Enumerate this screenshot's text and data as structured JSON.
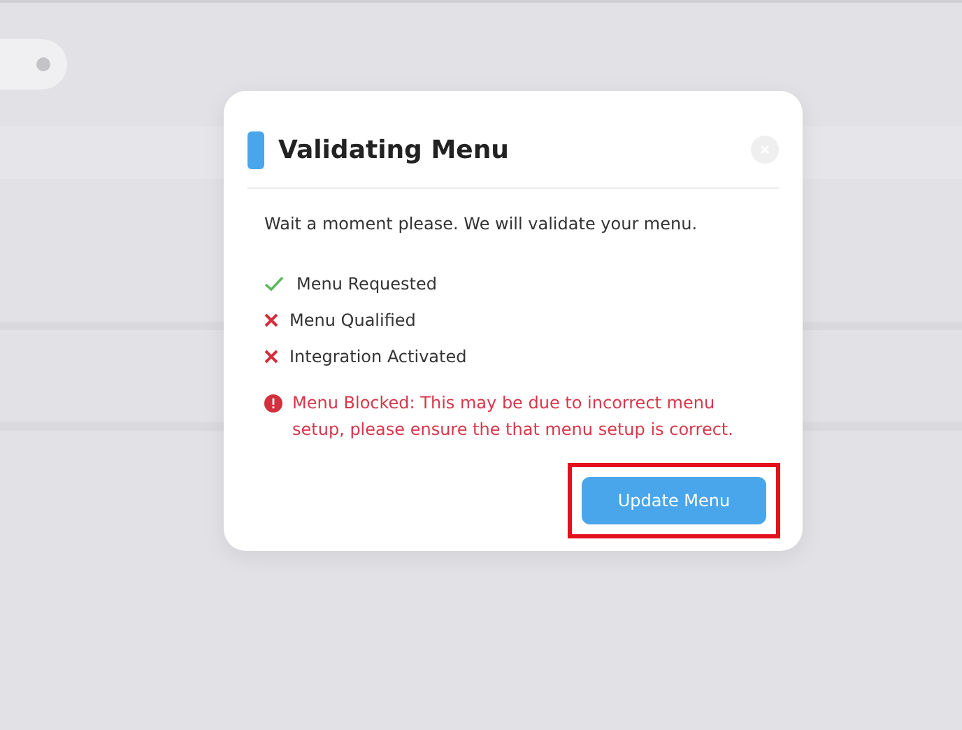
{
  "dialog": {
    "title": "Validating Menu",
    "message": "Wait a moment please. We will validate your menu.",
    "steps": [
      {
        "label": "Menu Requested",
        "passed": true
      },
      {
        "label": "Menu Qualified",
        "passed": false
      },
      {
        "label": "Integration Activated",
        "passed": false
      }
    ],
    "error": "Menu Blocked: This may be due to incorrect menu setup, please ensure the that menu setup is correct.",
    "button": {
      "label": "Update Menu",
      "highlighted": true
    }
  }
}
